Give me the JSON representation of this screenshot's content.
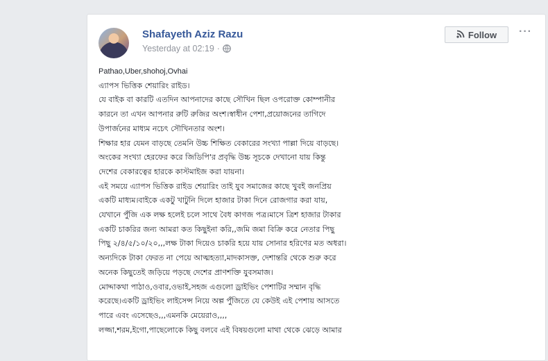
{
  "post": {
    "author": "Shafayeth Aziz Razu",
    "timestamp": "Yesterday at 02:19",
    "separator": "·",
    "follow_label": "Follow",
    "more_label": "···",
    "lines": [
      "Pathao,Uber,shohoj,Ovhai",
      "এ্যাপস ভিত্তিক শেয়ারিং রাইড।",
      "যে বাইক বা কারটি এতদিন আপনাদের কাছে সৌখিন ছিল ওপরোক্ত কোম্পানীর",
      "কারনে তা এখন আপনার রুটি রুজির অংশ।স্বাধীন পেশা,প্রয়োজনের তাগিদে",
      "উপার্জনের মাধ্যম নচেৎ সৌখিনতার অংশ।",
      "শিক্ষার হার যেমন বাড়ছে তেমনি উচ্চ শিক্ষিত বেকারের সংখ্যা পাল্লা দিয়ে বাড়ছে।",
      "অংকের সংখ্যা হেরফের করে জিডিপি'র প্রবৃদ্ধি উচ্চ সূচকে দেখানো যায় কিন্তু",
      "দেশের বেকারত্বের হারকে কাস্টমাইজ করা যায়না।",
      "এই সময়ে এ্যাপস ভিত্তিক রাইড শেয়ারিং তাই যুব সমাজের কাছে খুবই জনপ্রিয়",
      "একটি মাধ্যম।বাইকে একটু খাটুনি দিলে হাজার টাকা দিনে রোজগার করা যায়,",
      "যেখানে পুঁজি এক লক্ষ হলেই চলে সাথে বৈধ কাগজ পত্র।মাসে ত্রিশ হাজার টাকার",
      "একটি চাকরির জন্য আমরা কত কিছুইনা করি,,জমি জমা বিক্রি করে নেতার পিছু",
      "পিছু ২/৪/৫/১০/২০,,,লক্ষ টাকা দিয়েও চাকরি হয়ে যায় সোনার হরিণের মত অধরা।",
      "অন্যদিকে টাকা ফেরত না পেয়ে আত্মহত্যা,মাদকাসক্ত, দেশান্তরি থেকে শুরু করে",
      "অনেক কিছুতেই জড়িয়ে পড়ছে দেশের প্রাণশক্তি যুবসমাজ।",
      "মোদ্দাকথা পাঠাও,ওবার,ওভাই,সহজ এগুলো ড্রাইভিং পেশাটির সম্মান বৃদ্ধি",
      "করেছে।একটি ড্রাইভিং লাইসেন্স নিয়ে অল্প পুঁজিতে যে কেউই এই পেশায় আসতে",
      "পারে এবং এসেছেও,,,এমনকি মেয়েরাও,,,,",
      "লজ্জা,শরম,ইগো,পাছেলোকে কিছু বলবে এই বিষয়গুলো মাথা থেকে ঝেড়ে আমার"
    ]
  },
  "colors": {
    "author": "#365899",
    "meta": "#90949c",
    "text": "#1d2129",
    "background": "#e9ebee"
  }
}
